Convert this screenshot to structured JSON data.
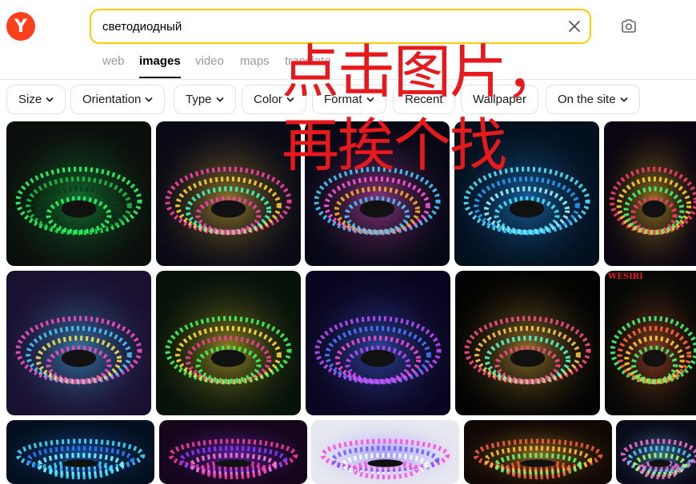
{
  "header": {
    "logo_letter": "Y",
    "search": {
      "value": "светодиодный"
    },
    "tabs": [
      "web",
      "images",
      "video",
      "maps",
      "translate"
    ],
    "active_tab": "images"
  },
  "filters": [
    "Size",
    "Orientation",
    "Type",
    "Color",
    "Format",
    "Recent",
    "Wallpaper",
    "On the site"
  ],
  "overlay": {
    "line1": "点击图片，",
    "line2": "再挨个找"
  },
  "results": {
    "watermark": "WESIRI",
    "tiles": [
      {
        "name": "led-strip-image-1",
        "colors": [
          "#2aff6a",
          "#19c24a",
          "#0a3a1a"
        ],
        "bg": "#0b0f0c"
      },
      {
        "name": "led-strip-image-2",
        "colors": [
          "#ff3fb0",
          "#ffd23a",
          "#3affc0"
        ],
        "bg": "#0a0a16"
      },
      {
        "name": "led-strip-image-3",
        "colors": [
          "#3ad0ff",
          "#ff5ad9",
          "#ffb020"
        ],
        "bg": "#050814"
      },
      {
        "name": "led-strip-image-4",
        "colors": [
          "#4de8ff",
          "#2aa0ff",
          "#9ff7ff"
        ],
        "bg": "#03101e"
      },
      {
        "name": "led-strip-image-5",
        "colors": [
          "#ff3a6a",
          "#ffd02a",
          "#3aff7a"
        ],
        "bg": "#0a0510"
      },
      {
        "name": "led-strip-image-6",
        "colors": [
          "#ff4ac0",
          "#4ac8ff",
          "#ffe04a"
        ],
        "bg": "#1a1030"
      },
      {
        "name": "led-strip-image-7",
        "colors": [
          "#3aff5a",
          "#ffe03a",
          "#ff3a9a"
        ],
        "bg": "#06120a"
      },
      {
        "name": "led-strip-image-8",
        "colors": [
          "#c04aff",
          "#4a7aff",
          "#ff4ad0"
        ],
        "bg": "#0a0520"
      },
      {
        "name": "led-strip-image-9",
        "colors": [
          "#ff4a8a",
          "#ffc84a",
          "#4affd0"
        ],
        "bg": "#030303"
      },
      {
        "name": "led-strip-image-10",
        "colors": [
          "#3aff7a",
          "#ff6a3a",
          "#ffd03a"
        ],
        "bg": "#050805"
      },
      {
        "name": "led-strip-image-11",
        "colors": [
          "#3ae0ff",
          "#2a80ff",
          "#7affff"
        ],
        "bg": "#041020"
      },
      {
        "name": "led-strip-image-12",
        "colors": [
          "#ff3a9a",
          "#8a3aff",
          "#ff7ad0"
        ],
        "bg": "#15051a"
      },
      {
        "name": "led-strip-image-13",
        "colors": [
          "#ff4ae0",
          "#6a5aff",
          "#ffffff"
        ],
        "bg": "#e8e8f0"
      },
      {
        "name": "led-strip-image-14",
        "colors": [
          "#ff5a3a",
          "#ffc03a",
          "#5aff7a"
        ],
        "bg": "#100805"
      },
      {
        "name": "led-strip-image-15",
        "colors": [
          "#ff6ad0",
          "#5ac8ff",
          "#b0ff5a"
        ],
        "bg": "#0a0a18"
      }
    ]
  }
}
